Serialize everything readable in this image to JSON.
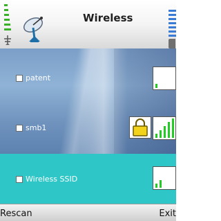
{
  "header": {
    "title": "Wireless",
    "signal_icon": "signal-strength-icon",
    "app_icon": "satellite-dish-icon",
    "battery_icon": "battery-icon",
    "colors": {
      "signal_green": "#3ab028",
      "battery_blue": "#3a7bd5"
    }
  },
  "networks": [
    {
      "label": "patent",
      "checked": false,
      "secured": false,
      "signal_level": 0.2
    },
    {
      "label": "smb1",
      "checked": false,
      "secured": true,
      "signal_level": 1.0
    },
    {
      "label": "Wireless SSID",
      "checked": false,
      "secured": false,
      "signal_level": 0.4,
      "selected": true
    }
  ],
  "softkeys": {
    "left": "Rescan",
    "right": "Exit"
  },
  "colors": {
    "selection": "#2ec6c6",
    "signal_bar": "#22cc22",
    "lock": "#f2d21b"
  }
}
